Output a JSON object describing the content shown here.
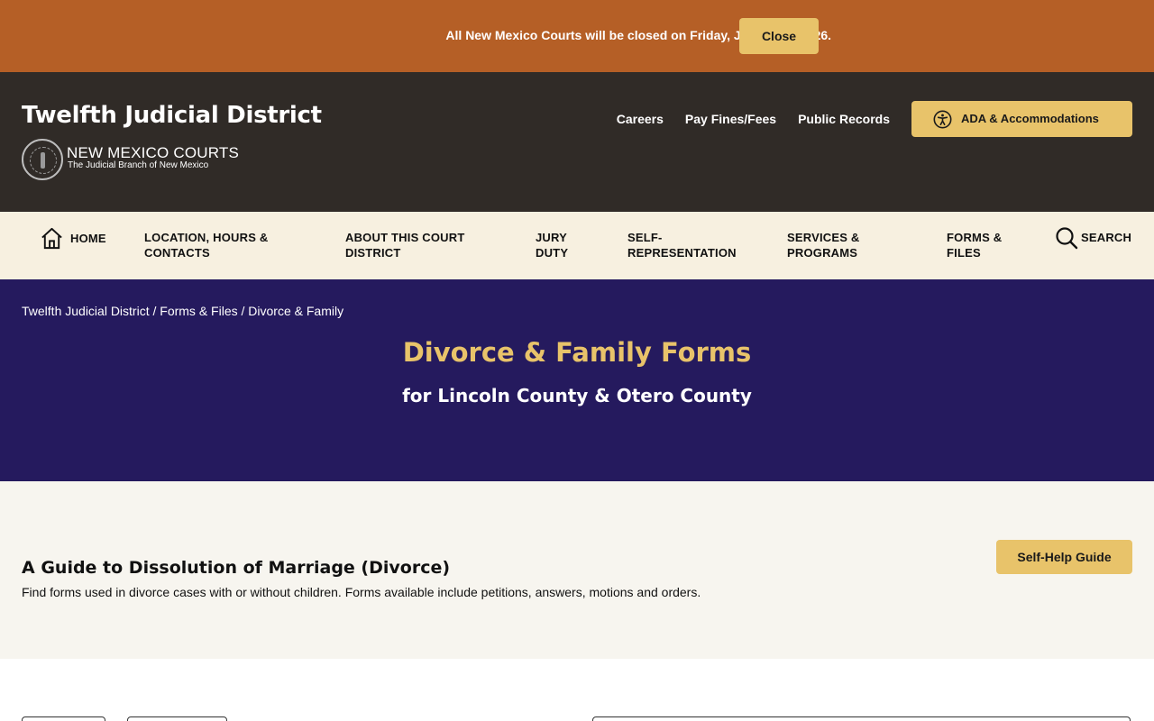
{
  "alert": {
    "message": "All New Mexico Courts will be closed on Friday, June 19th, 2026.",
    "close_label": "Close"
  },
  "header": {
    "site_title": "Twelfth Judicial District",
    "logo_name": "NEW MEXICO COURTS",
    "logo_tagline": "The Judicial Branch of New Mexico",
    "utility_links": [
      "Careers",
      "Pay Fines/Fees",
      "Public Records"
    ],
    "ada_label": "ADA & Accommodations"
  },
  "nav": {
    "home": "HOME",
    "location": "LOCATION, HOURS & CONTACTS",
    "about": "ABOUT THIS COURT DISTRICT",
    "jury": "JURY DUTY",
    "self_rep": "SELF-REPRESENTATION",
    "services": "SERVICES & PROGRAMS",
    "forms": "FORMS & FILES",
    "search": "SEARCH"
  },
  "breadcrumb": {
    "items": [
      "Twelfth Judicial District",
      "Forms & Files",
      "Divorce & Family"
    ],
    "separator": " / "
  },
  "hero": {
    "title": "Divorce & Family Forms",
    "subtitle": "for Lincoln County & Otero County"
  },
  "guide": {
    "title": "A Guide to Dissolution of Marriage (Divorce)",
    "description": "Find forms used in divorce cases with or without children. Forms available include petitions, answers, motions and orders.",
    "button_label": "Self-Help Guide"
  },
  "colors": {
    "alert_bg": "#b55f26",
    "header_bg": "#302b27",
    "accent_gold": "#e8c36a",
    "nav_bg": "#f7f0e0",
    "hero_bg": "#251a5e",
    "guide_bg": "#f7f5ef"
  },
  "icons": {
    "ada": "accessibility-icon",
    "home": "home-icon",
    "search": "magnifier-icon",
    "seal": "court-seal-icon"
  }
}
